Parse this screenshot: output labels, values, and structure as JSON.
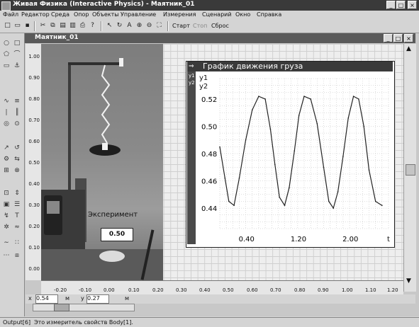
{
  "window": {
    "title": "Живая Физика (Interactive Physics) - Маятник_01",
    "minimize": "_",
    "maximize": "□",
    "close": "×"
  },
  "menu": [
    "Файл",
    "Редактор",
    "Среда",
    "Опор",
    "Объекты",
    "Управление",
    "Измерения",
    "Сценарий",
    "Окно",
    "Справка"
  ],
  "toolbar": {
    "start_label": "Старт",
    "stop_label": "Стоп",
    "reset_label": "Сброс"
  },
  "document": {
    "title": "Маятник_01"
  },
  "experiment": {
    "label": "Эксперимент",
    "value": "0.50"
  },
  "graph": {
    "title": "График движения груза",
    "y_labels": [
      "y1",
      "y2"
    ],
    "x_axis_label": "t"
  },
  "chart_data": {
    "type": "line",
    "title": "График движения груза",
    "xlabel": "t",
    "ylabel": "y1",
    "xlim": [
      0.0,
      2.6
    ],
    "ylim": [
      0.425,
      0.535
    ],
    "x_ticks": [
      "0.40",
      "1.20",
      "2.00"
    ],
    "y_ticks": [
      "0.52",
      "0.50",
      "0.48",
      "0.46",
      "0.44"
    ],
    "grid": true,
    "series": [
      {
        "name": "y1",
        "x": [
          0.0,
          0.08,
          0.14,
          0.22,
          0.3,
          0.4,
          0.5,
          0.6,
          0.7,
          0.78,
          0.85,
          0.92,
          1.0,
          1.07,
          1.15,
          1.22,
          1.3,
          1.4,
          1.5,
          1.6,
          1.68,
          1.75,
          1.82,
          1.9,
          1.98,
          2.06,
          2.14,
          2.22,
          2.3,
          2.4,
          2.5
        ],
        "y": [
          0.485,
          0.462,
          0.445,
          0.442,
          0.462,
          0.49,
          0.512,
          0.522,
          0.52,
          0.498,
          0.472,
          0.448,
          0.442,
          0.455,
          0.482,
          0.508,
          0.522,
          0.52,
          0.502,
          0.47,
          0.445,
          0.44,
          0.452,
          0.478,
          0.506,
          0.522,
          0.52,
          0.5,
          0.468,
          0.445,
          0.442
        ]
      }
    ]
  },
  "rulers": {
    "vertical": [
      "1.00",
      "0.90",
      "0.80",
      "0.70",
      "0.60",
      "0.50",
      "0.40",
      "0.30",
      "0.20",
      "0.10",
      "0.00"
    ],
    "horizontal": [
      "-0.20",
      "-0.10",
      "0.00",
      "0.10",
      "0.20",
      "0.30",
      "0.40",
      "0.50",
      "0.60",
      "0.70",
      "0.80",
      "0.90",
      "1.00",
      "1.10",
      "1.20"
    ]
  },
  "coords": {
    "x_label": "x",
    "x_value": "0.54",
    "x_unit": "м",
    "y_label": "y",
    "y_value": "0.27",
    "y_unit": "м"
  },
  "status": {
    "left": "Output[6]",
    "message": "Это измеритель свойств Body[1]."
  }
}
